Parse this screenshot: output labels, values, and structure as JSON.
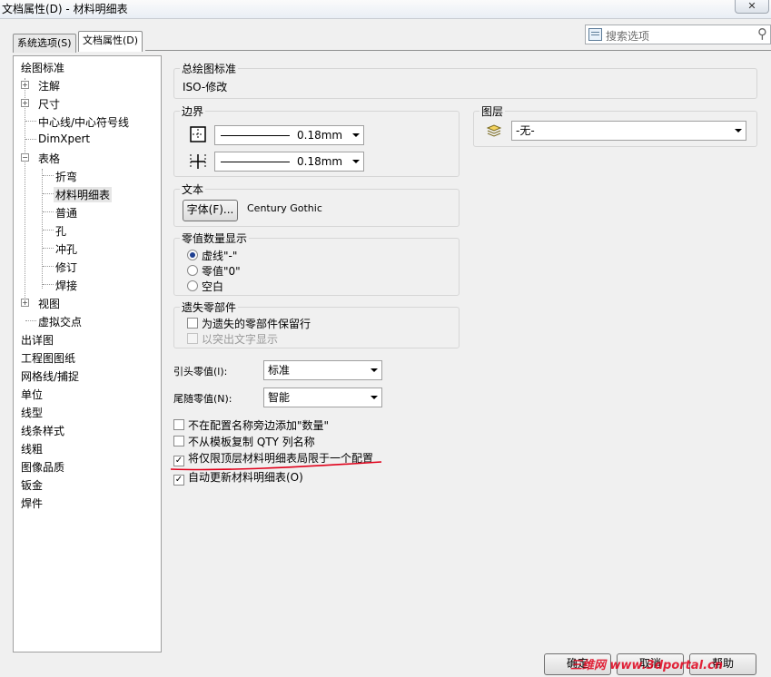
{
  "window": {
    "title": "文档属性(D) - 材料明细表",
    "close_label": "✕"
  },
  "tabs": [
    {
      "label": "系统选项(S)"
    },
    {
      "label": "文档属性(D)"
    }
  ],
  "search": {
    "placeholder": "搜索选项"
  },
  "tree": {
    "items": [
      {
        "label": "绘图标准"
      },
      {
        "label": "注解"
      },
      {
        "label": "尺寸"
      },
      {
        "label": "中心线/中心符号线"
      },
      {
        "label": "DimXpert"
      },
      {
        "label": "表格"
      },
      {
        "label": "折弯"
      },
      {
        "label": "材料明细表"
      },
      {
        "label": "普通"
      },
      {
        "label": "孔"
      },
      {
        "label": "冲孔"
      },
      {
        "label": "修订"
      },
      {
        "label": "焊接"
      },
      {
        "label": "视图"
      },
      {
        "label": "虚拟交点"
      },
      {
        "label": "出详图"
      },
      {
        "label": "工程图图纸"
      },
      {
        "label": "网格线/捕捉"
      },
      {
        "label": "单位"
      },
      {
        "label": "线型"
      },
      {
        "label": "线条样式"
      },
      {
        "label": "线粗"
      },
      {
        "label": "图像品质"
      },
      {
        "label": "钣金"
      },
      {
        "label": "焊件"
      }
    ]
  },
  "overall_standard": {
    "label": "总绘图标准",
    "value": "ISO-修改"
  },
  "border": {
    "label": "边界",
    "line1": "0.18mm",
    "line2": "0.18mm"
  },
  "layer": {
    "label": "图层",
    "value": "-无-"
  },
  "text": {
    "label": "文本",
    "font_button": "字体(F)...",
    "font_name": "Century Gothic"
  },
  "zero_qty": {
    "label": "零值数量显示",
    "options": [
      {
        "label": "虚线\"-\""
      },
      {
        "label": "零值\"0\""
      },
      {
        "label": "空白"
      }
    ],
    "selected": 0
  },
  "missing": {
    "label": "遗失零部件",
    "keep_rows": {
      "label": "为遗失的零部件保留行",
      "checked": false
    },
    "strike": {
      "label": "以突出文字显示",
      "checked": false,
      "disabled": true
    }
  },
  "leading_zeros": {
    "label": "引头零值(l):",
    "value": "标准"
  },
  "trailing_zeros": {
    "label": "尾随零值(N):",
    "value": "智能"
  },
  "checkboxes": [
    {
      "label": "不在配置名称旁边添加\"数量\"",
      "checked": false
    },
    {
      "label": "不从模板复制 QTY 列名称",
      "checked": false
    },
    {
      "label": "将仅限顶层材料明细表局限于一个配置",
      "checked": true
    },
    {
      "label": "自动更新材料明细表(O)",
      "checked": true
    }
  ],
  "buttons": {
    "ok": "确定",
    "cancel": "取消",
    "help": "帮助"
  },
  "watermark": "三维网 www.3dportal.cn",
  "colors": {
    "annotation_red": "#e0001a",
    "radio_blue": "#1e3f90"
  }
}
